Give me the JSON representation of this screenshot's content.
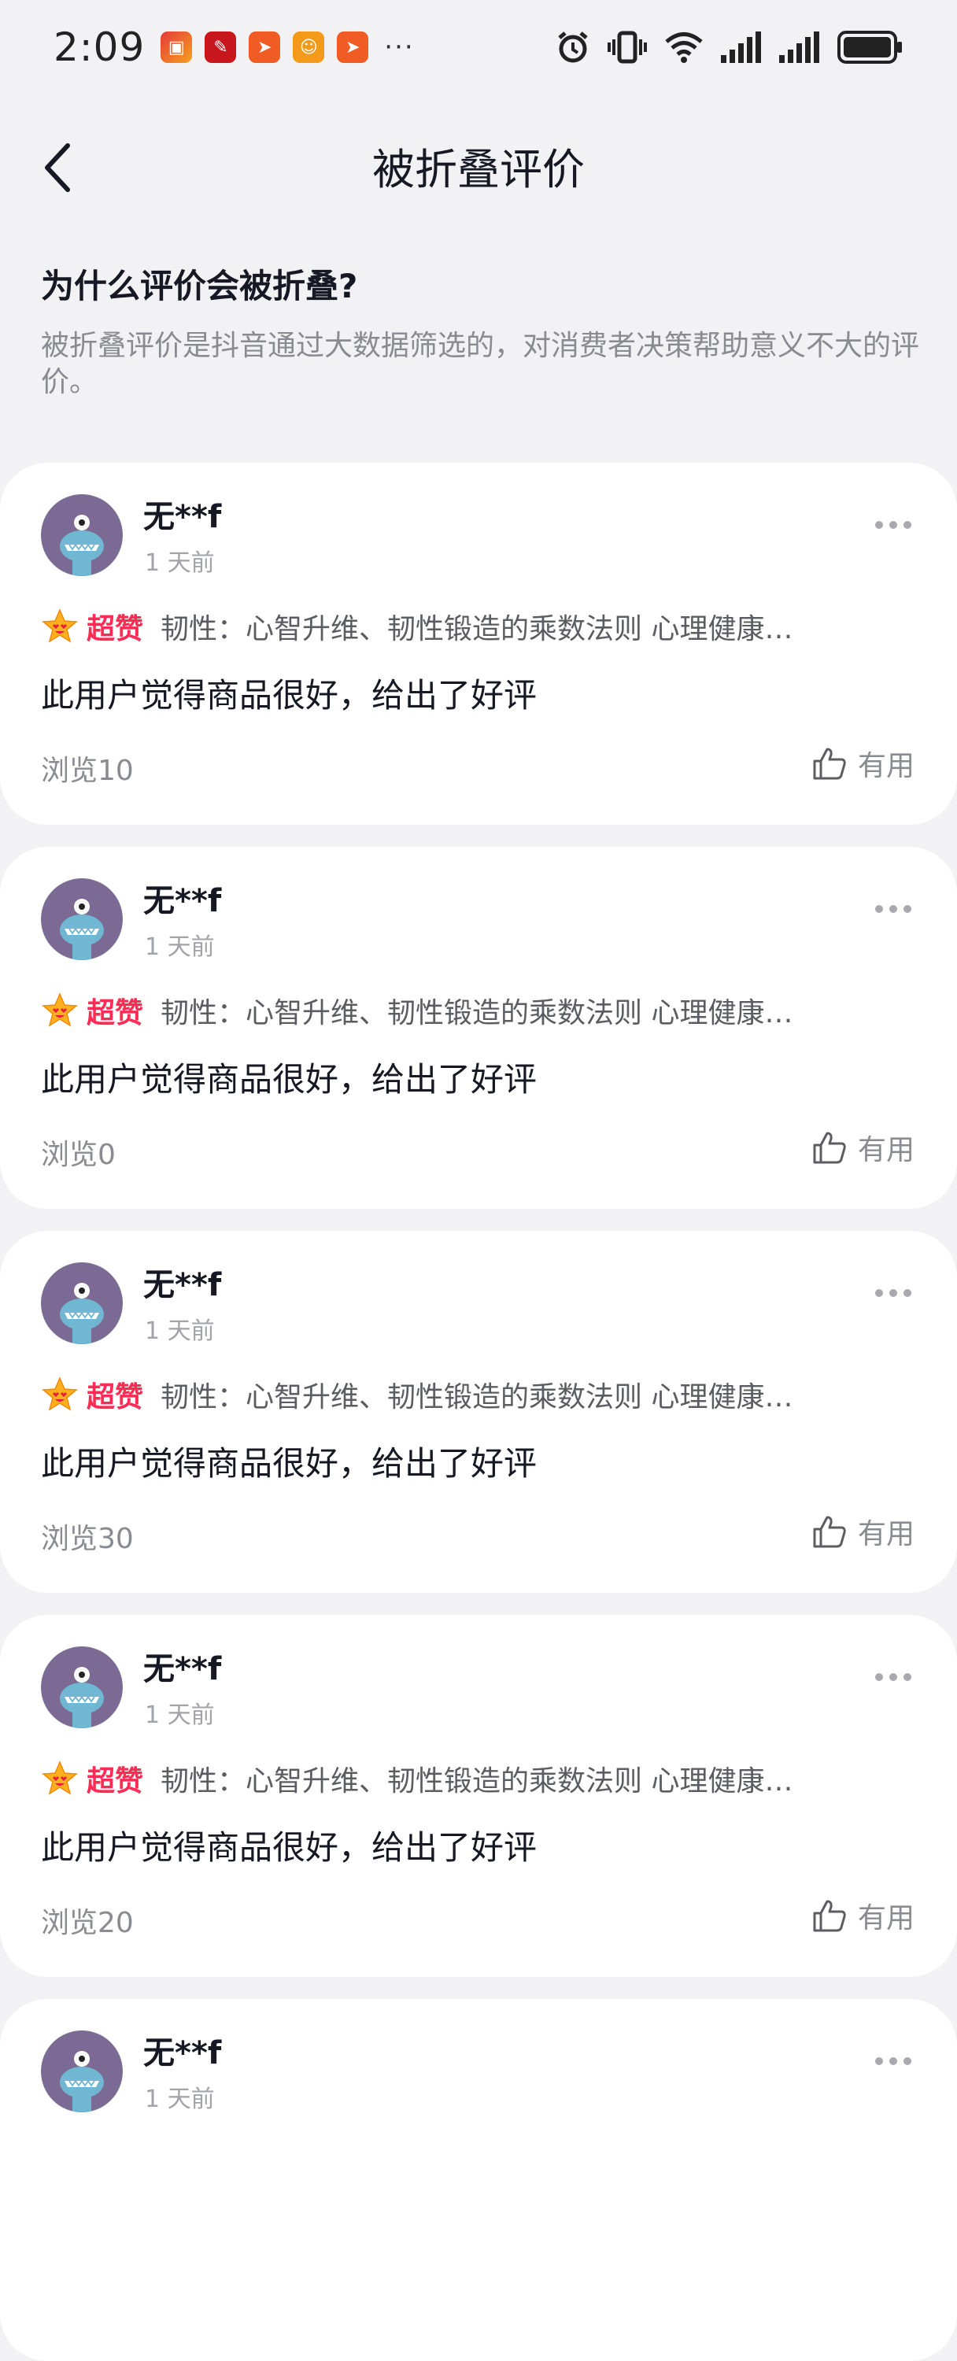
{
  "status_bar": {
    "time": "2:09",
    "notification_icons": [
      "app-red-icon",
      "app-news-icon",
      "app-send-icon",
      "app-orange-icon",
      "app-send-icon"
    ],
    "more": "···"
  },
  "header": {
    "title": "被折叠评价"
  },
  "info": {
    "title": "为什么评价会被折叠?",
    "description": "被折叠评价是抖音通过大数据筛选的，对消费者决策帮助意义不大的评价。"
  },
  "reviews": [
    {
      "user": "无**f",
      "time": "1 天前",
      "rating_label": "超赞",
      "product": "韧性：心智升维、韧性锻造的乘数法则 心理健康…",
      "content": "此用户觉得商品很好，给出了好评",
      "views": "浏览10",
      "useful": "有用"
    },
    {
      "user": "无**f",
      "time": "1 天前",
      "rating_label": "超赞",
      "product": "韧性：心智升维、韧性锻造的乘数法则 心理健康…",
      "content": "此用户觉得商品很好，给出了好评",
      "views": "浏览0",
      "useful": "有用"
    },
    {
      "user": "无**f",
      "time": "1 天前",
      "rating_label": "超赞",
      "product": "韧性：心智升维、韧性锻造的乘数法则 心理健康…",
      "content": "此用户觉得商品很好，给出了好评",
      "views": "浏览30",
      "useful": "有用"
    },
    {
      "user": "无**f",
      "time": "1 天前",
      "rating_label": "超赞",
      "product": "韧性：心智升维、韧性锻造的乘数法则 心理健康…",
      "content": "此用户觉得商品很好，给出了好评",
      "views": "浏览20",
      "useful": "有用"
    },
    {
      "user": "无**f",
      "time": "1 天前"
    }
  ],
  "colors": {
    "accent": "#fe2c55",
    "background": "#f2f2f4",
    "card": "#ffffff",
    "avatar_bg": "#7b6a93"
  }
}
